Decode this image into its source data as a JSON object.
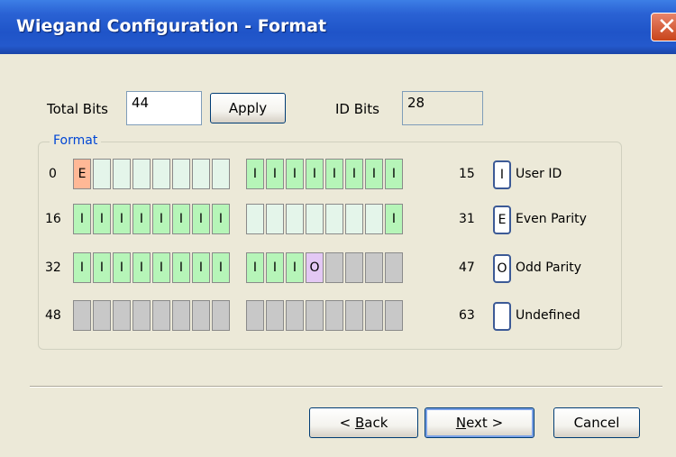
{
  "window": {
    "title": "Wiegand Configuration - Format",
    "close_glyph": "✕"
  },
  "total_bits": {
    "label": "Total Bits",
    "value": "44"
  },
  "apply_button": "Apply",
  "id_bits": {
    "label": "ID Bits",
    "value": "28"
  },
  "format": {
    "group_label": "Format",
    "rows": [
      {
        "start": "0",
        "end": "15",
        "cells": [
          "E",
          "",
          "",
          "",
          "",
          "",
          "",
          "",
          "I",
          "I",
          "I",
          "I",
          "I",
          "I",
          "I",
          "I"
        ]
      },
      {
        "start": "16",
        "end": "31",
        "cells": [
          "I",
          "I",
          "I",
          "I",
          "I",
          "I",
          "I",
          "I",
          "",
          "",
          "",
          "",
          "",
          "",
          "",
          "I"
        ]
      },
      {
        "start": "32",
        "end": "47",
        "cells": [
          "I",
          "I",
          "I",
          "I",
          "I",
          "I",
          "I",
          "I",
          "I",
          "I",
          "I",
          "O",
          "",
          "",
          "",
          ""
        ]
      },
      {
        "start": "48",
        "end": "63",
        "cells": [
          "",
          "",
          "",
          "",
          "",
          "",
          "",
          "",
          "",
          "",
          "",
          "",
          "",
          "",
          "",
          ""
        ]
      }
    ]
  },
  "legend": [
    {
      "symbol": "I",
      "label": "User ID"
    },
    {
      "symbol": "E",
      "label": "Even Parity"
    },
    {
      "symbol": "O",
      "label": "Odd Parity"
    },
    {
      "symbol": "",
      "label": "Undefined"
    }
  ],
  "buttons": {
    "back_mnemonic": "B",
    "back_rest": "ack",
    "back_prefix": "< ",
    "next_mnemonic": "N",
    "next_rest": "ext",
    "next_suffix": " >",
    "cancel": "Cancel"
  }
}
